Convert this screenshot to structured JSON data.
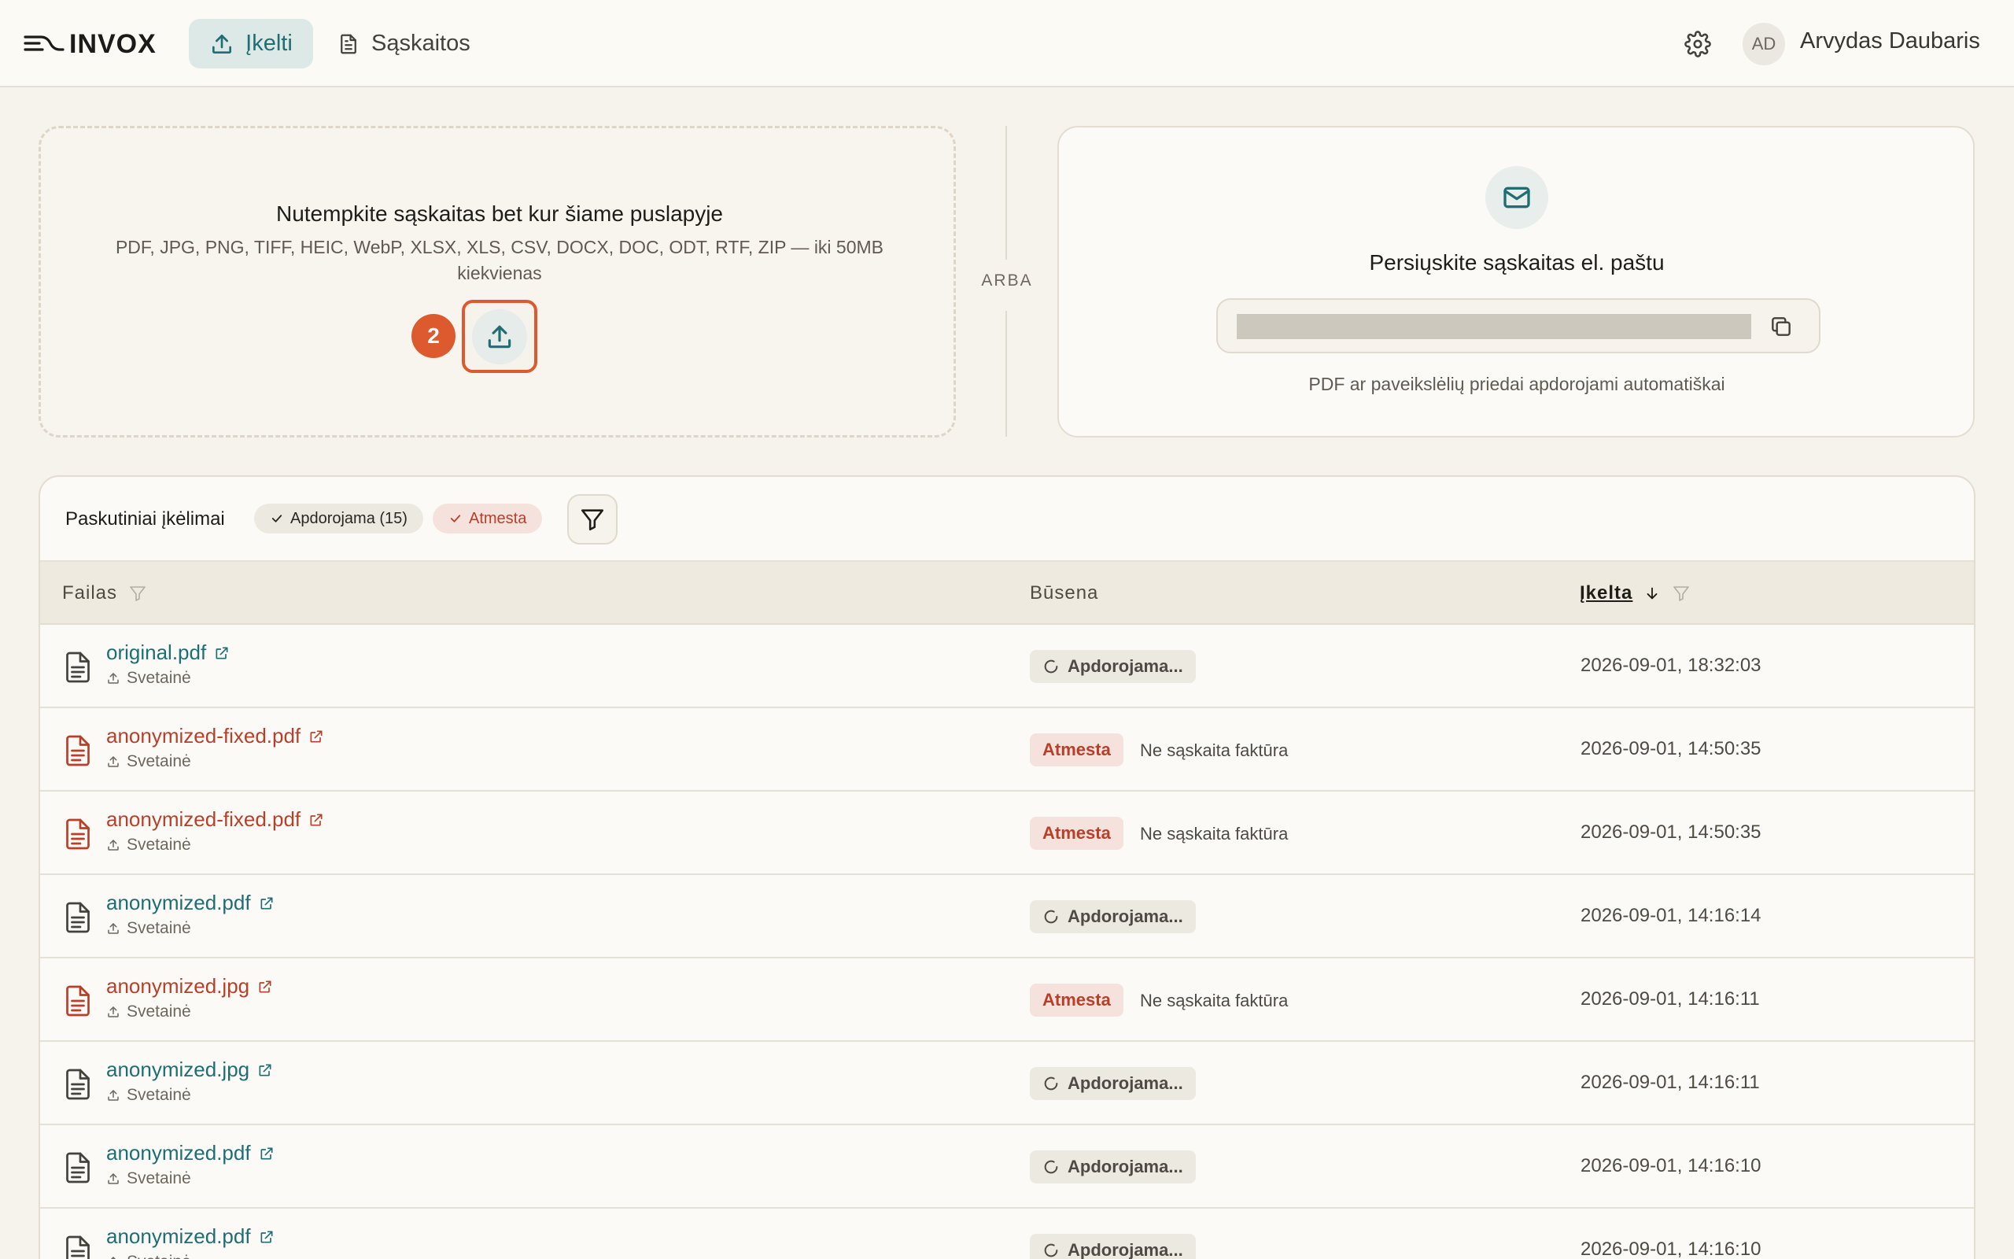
{
  "header": {
    "logo_text": "INVOX",
    "nav_upload": "Įkelti",
    "nav_invoices": "Sąskaitos",
    "avatar_initials": "AD",
    "user_name": "Arvydas Daubaris"
  },
  "dropzone": {
    "title": "Nutempkite sąskaitas bet kur šiame puslapyje",
    "subtitle": "PDF, JPG, PNG, TIFF, HEIC, WebP, XLSX, XLS, CSV, DOCX, DOC, ODT, RTF, ZIP — iki 50MB kiekvienas",
    "step_number": "2"
  },
  "divider_label": "ARBA",
  "email": {
    "title": "Persiųskite sąskaitas el. paštu",
    "hint": "PDF ar paveikslėlių priedai apdorojami automatiškai"
  },
  "table": {
    "title": "Paskutiniai įkėlimai",
    "filter_chips": [
      {
        "label": "Apdorojama (15)"
      },
      {
        "label": "Atmesta"
      }
    ],
    "columns": {
      "file": "Failas",
      "status": "Būsena",
      "uploaded": "Įkelta"
    },
    "rows": [
      {
        "file": "original.pdf",
        "source": "Svetainė",
        "status": "Apdorojama...",
        "reason": "",
        "uploaded": "2026-09-01, 18:32:03"
      },
      {
        "file": "anonymized-fixed.pdf",
        "source": "Svetainė",
        "status": "Atmesta",
        "reason": "Ne sąskaita faktūra",
        "uploaded": "2026-09-01, 14:50:35"
      },
      {
        "file": "anonymized-fixed.pdf",
        "source": "Svetainė",
        "status": "Atmesta",
        "reason": "Ne sąskaita faktūra",
        "uploaded": "2026-09-01, 14:50:35"
      },
      {
        "file": "anonymized.pdf",
        "source": "Svetainė",
        "status": "Apdorojama...",
        "reason": "",
        "uploaded": "2026-09-01, 14:16:14"
      },
      {
        "file": "anonymized.jpg",
        "source": "Svetainė",
        "status": "Atmesta",
        "reason": "Ne sąskaita faktūra",
        "uploaded": "2026-09-01, 14:16:11"
      },
      {
        "file": "anonymized.jpg",
        "source": "Svetainė",
        "status": "Apdorojama...",
        "reason": "",
        "uploaded": "2026-09-01, 14:16:11"
      },
      {
        "file": "anonymized.pdf",
        "source": "Svetainė",
        "status": "Apdorojama...",
        "reason": "",
        "uploaded": "2026-09-01, 14:16:10"
      },
      {
        "file": "anonymized.pdf",
        "source": "Svetainė",
        "status": "Apdorojama...",
        "reason": "",
        "uploaded": "2026-09-01, 14:16:10"
      }
    ]
  },
  "colors": {
    "accent": "#1e6e74",
    "rejected": "#b8402a",
    "highlight": "#dc5a2d",
    "background": "#f6f3ec"
  }
}
